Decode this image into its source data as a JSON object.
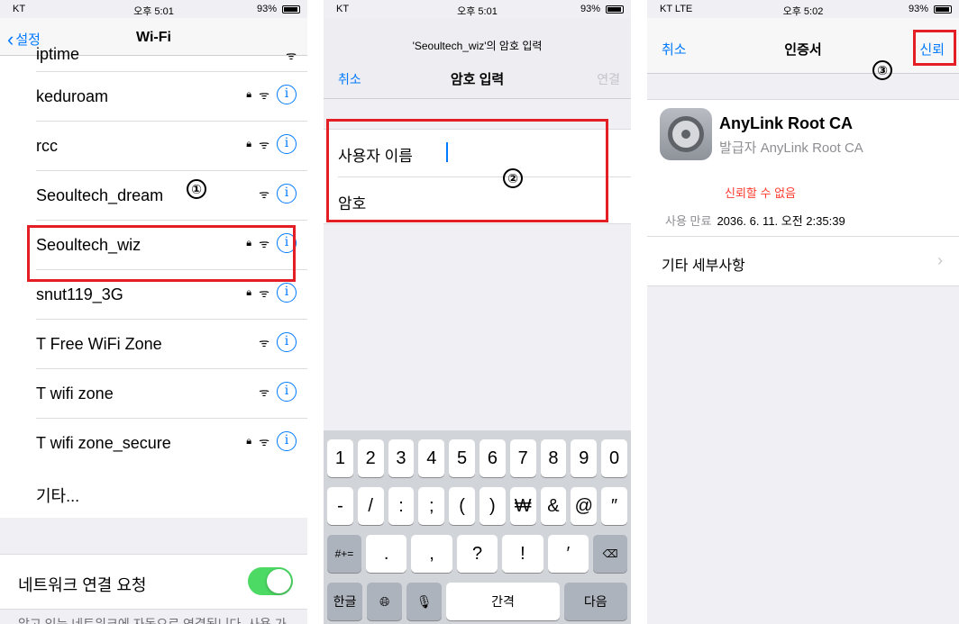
{
  "panel1": {
    "status": {
      "carrier": "KT",
      "time": "오후 5:01",
      "battery": "93%"
    },
    "back_label": "설정",
    "title": "Wi-Fi",
    "partial_network": "iptime",
    "networks": [
      {
        "name": "keduroam",
        "locked": true
      },
      {
        "name": "rcc",
        "locked": true
      },
      {
        "name": "Seoultech_dream",
        "locked": false
      },
      {
        "name": "Seoultech_wiz",
        "locked": true
      },
      {
        "name": "snut119_3G",
        "locked": true
      },
      {
        "name": "T Free WiFi Zone",
        "locked": false
      },
      {
        "name": "T wifi zone",
        "locked": false
      },
      {
        "name": "T wifi zone_secure",
        "locked": true
      }
    ],
    "other_label": "기타...",
    "ask_join_label": "네트워크 연결 요청",
    "ask_join_enabled": true,
    "footnote": "알고 있는 네트워크에 자동으로 연결됩니다. 사용 가",
    "annotation": "①"
  },
  "panel2": {
    "status": {
      "carrier": "KT",
      "time": "오후 5:01",
      "battery": "93%"
    },
    "prompt": "'Seoultech_wiz'의 암호 입력",
    "cancel_label": "취소",
    "title": "암호 입력",
    "join_label": "연결",
    "username_label": "사용자 이름",
    "password_label": "암호",
    "annotation": "②",
    "keyboard": {
      "row1": [
        "1",
        "2",
        "3",
        "4",
        "5",
        "6",
        "7",
        "8",
        "9",
        "0"
      ],
      "row2": [
        "-",
        "/",
        ":",
        ";",
        "(",
        ")",
        "₩",
        "&",
        "@",
        "″"
      ],
      "row3": [
        "#+=",
        ".",
        ",",
        "?",
        "!",
        "′",
        "⌫"
      ],
      "row4": [
        "한글",
        "globe",
        "mic",
        "간격",
        "다음"
      ]
    }
  },
  "panel3": {
    "status": {
      "carrier": "KT LTE",
      "time": "오후 5:02",
      "battery": "93%"
    },
    "cancel_label": "취소",
    "title": "인증서",
    "trust_label": "신뢰",
    "annotation": "③",
    "cert_name": "AnyLink Root CA",
    "cert_issuer": "발급자 AnyLink Root CA",
    "cert_status": "신뢰할 수 없음",
    "expiry_key": "사용 만료",
    "expiry_value": "2036. 6. 11. 오전 2:35:39",
    "more_details_label": "기타 세부사항"
  },
  "colors": {
    "accent": "#007aff",
    "highlight": "#e31e24",
    "toggle_on": "#4cd964",
    "untrusted": "#ff3b30"
  }
}
